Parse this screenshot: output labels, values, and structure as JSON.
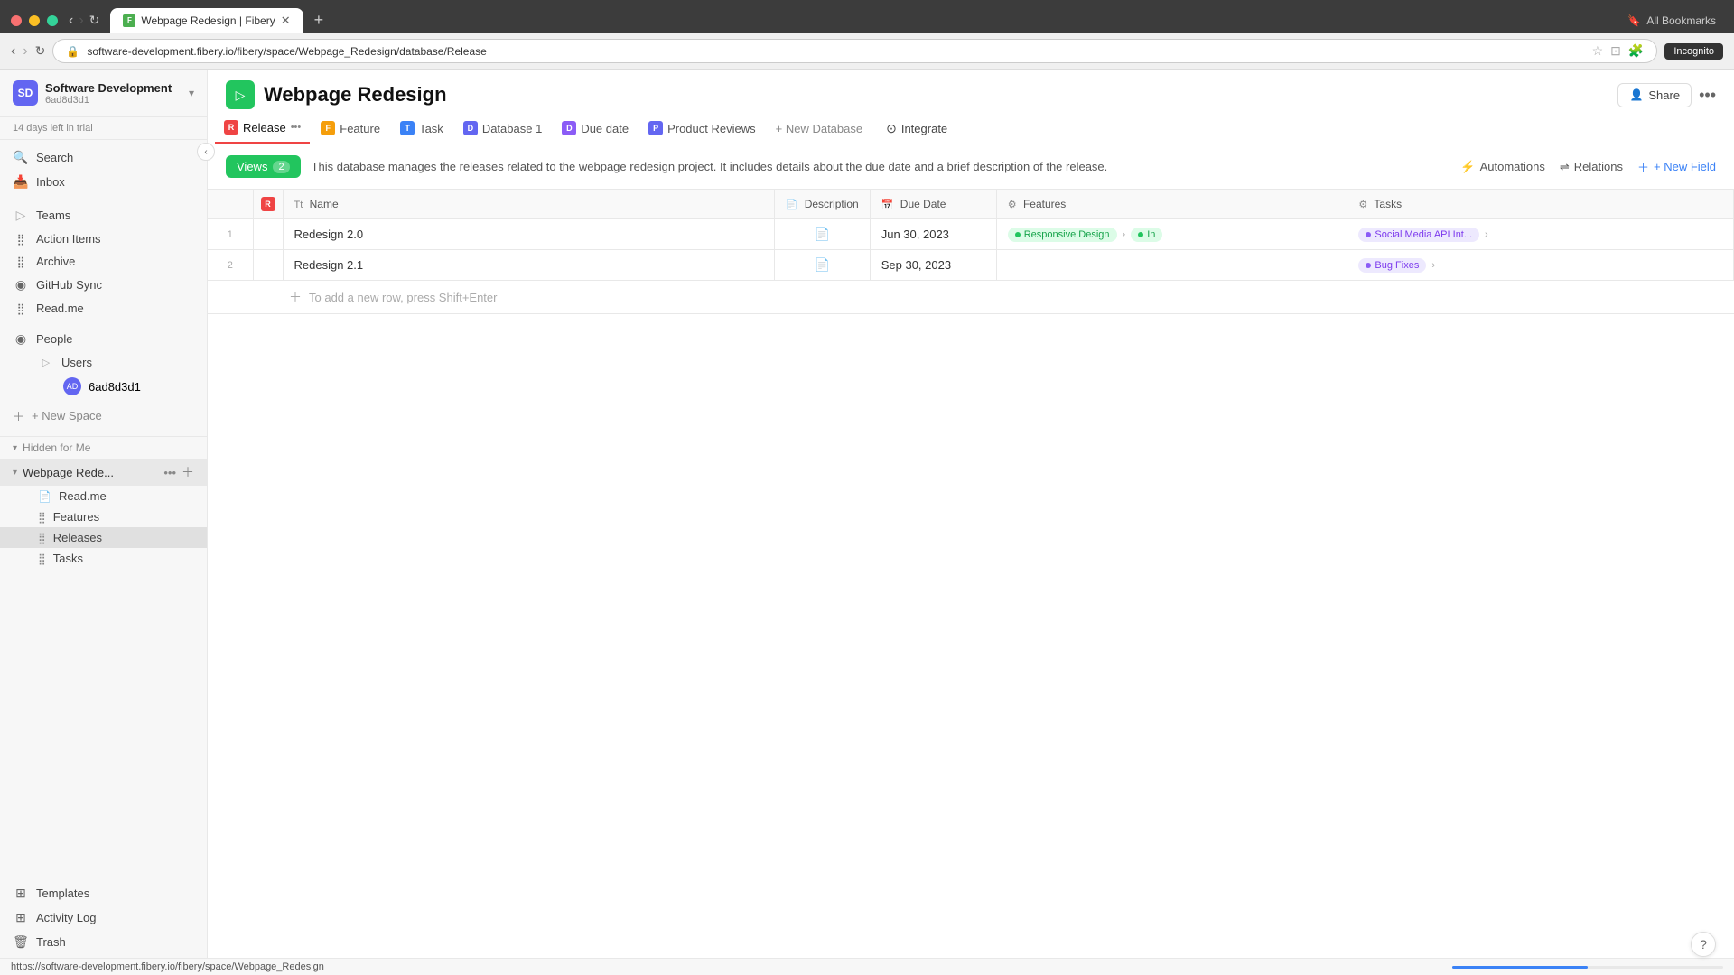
{
  "browser": {
    "tab_title": "Webpage Redesign | Fibery",
    "url": "software-development.fibery.io/fibery/space/Webpage_Redesign/database/Release",
    "new_tab_label": "+",
    "incognito_label": "Incognito",
    "all_bookmarks_label": "All Bookmarks"
  },
  "sidebar": {
    "workspace_name": "Software Development",
    "workspace_id": "6ad8d3d1",
    "trial_notice": "14 days left in trial",
    "nav_items": [
      {
        "id": "search",
        "label": "Search",
        "icon": "🔍"
      },
      {
        "id": "inbox",
        "label": "Inbox",
        "icon": "📥"
      }
    ],
    "groups": [
      {
        "id": "teams",
        "label": "Teams",
        "icon": "▷",
        "type": "group"
      },
      {
        "id": "action-items",
        "label": "Action Items",
        "icon": "⠿",
        "type": "item"
      },
      {
        "id": "archive",
        "label": "Archive",
        "icon": "⠿",
        "type": "item"
      },
      {
        "id": "github-sync",
        "label": "GitHub Sync",
        "icon": "◉",
        "type": "item"
      },
      {
        "id": "readme",
        "label": "Read.me",
        "icon": "⠿",
        "type": "item"
      }
    ],
    "people_section": {
      "label": "People",
      "items": [
        {
          "id": "users",
          "label": "Users",
          "icon": "▷"
        },
        {
          "id": "user-6ad8d3d1",
          "label": "6ad8d3d1",
          "avatar": "AD"
        }
      ]
    },
    "new_space_label": "+ New Space",
    "hidden_section": {
      "label": "Hidden for Me",
      "webpage_redesign": {
        "label": "Webpage Rede...",
        "sub_items": [
          {
            "id": "readme-sub",
            "label": "Read.me",
            "icon": "📄"
          },
          {
            "id": "features",
            "label": "Features",
            "icon": "⠿"
          },
          {
            "id": "releases",
            "label": "Releases",
            "icon": "⠿"
          },
          {
            "id": "tasks",
            "label": "Tasks",
            "icon": "⠿"
          }
        ]
      }
    },
    "bottom_items": [
      {
        "id": "templates",
        "label": "Templates",
        "icon": "⊞"
      },
      {
        "id": "activity-log",
        "label": "Activity Log",
        "icon": "⊞"
      },
      {
        "id": "trash",
        "label": "Trash",
        "icon": "🗑"
      }
    ]
  },
  "main": {
    "page_title": "Webpage Redesign",
    "page_icon": "▷",
    "share_label": "Share",
    "database_tabs": [
      {
        "id": "release",
        "label": "Release",
        "icon": "R",
        "active": true,
        "has_ellipsis": true
      },
      {
        "id": "feature",
        "label": "Feature",
        "icon": "F",
        "active": false
      },
      {
        "id": "task",
        "label": "Task",
        "icon": "T",
        "active": false
      },
      {
        "id": "database1",
        "label": "Database 1",
        "icon": "D",
        "active": false
      },
      {
        "id": "due-date",
        "label": "Due date",
        "icon": "D",
        "active": false
      },
      {
        "id": "product-reviews",
        "label": "Product Reviews",
        "icon": "P",
        "active": false
      }
    ],
    "new_database_label": "+ New Database",
    "integrate_label": "Integrate",
    "views_label": "Views",
    "views_count": "2",
    "description": "This database manages the releases related to the webpage redesign project. It includes details about the due date and a brief description of the release.",
    "automations_label": "Automations",
    "relations_label": "Relations",
    "new_field_label": "+ New Field",
    "table": {
      "columns": [
        {
          "id": "row-num",
          "label": ""
        },
        {
          "id": "r-col",
          "label": ""
        },
        {
          "id": "name",
          "label": "Name",
          "icon": "Tt"
        },
        {
          "id": "description",
          "label": "Description",
          "icon": "📄"
        },
        {
          "id": "due-date",
          "label": "Due Date",
          "icon": "📅"
        },
        {
          "id": "features",
          "label": "Features",
          "icon": "⚙"
        },
        {
          "id": "tasks",
          "label": "Tasks",
          "icon": "⚙"
        }
      ],
      "rows": [
        {
          "num": "1",
          "name": "Redesign 2.0",
          "description_icon": "📄",
          "due_date": "Jun 30, 2023",
          "features": [
            {
              "label": "Responsive Design",
              "type": "green",
              "has_chevron": true
            },
            {
              "label": "In",
              "type": "green",
              "has_chevron": false,
              "is_more": true
            }
          ],
          "tasks": [
            {
              "label": "Social Media API Int...",
              "type": "blue",
              "has_chevron": true
            }
          ]
        },
        {
          "num": "2",
          "name": "Redesign 2.1",
          "description_icon": "📄",
          "due_date": "Sep 30, 2023",
          "features": [],
          "tasks": [
            {
              "label": "Bug Fixes",
              "type": "blue",
              "has_chevron": true
            }
          ]
        }
      ],
      "add_row_hint": "To add a new row, press Shift+Enter"
    }
  },
  "bottom_bar": {
    "url": "https://software-development.fibery.io/fibery/space/Webpage_Redesign"
  },
  "help_label": "?"
}
